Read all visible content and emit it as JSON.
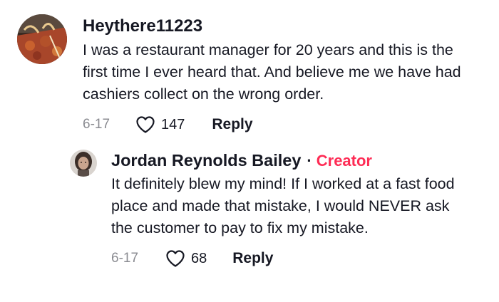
{
  "comments": [
    {
      "username": "Heythere11223",
      "text": "I was a restaurant manager for 20 years and this is the first time I ever heard that. And believe me we have had cashiers collect on the wrong order.",
      "date": "6-17",
      "likes": "147",
      "reply_label": "Reply",
      "avatar_icon": "pizza-avatar"
    }
  ],
  "reply": {
    "username": "Jordan Reynolds Bailey",
    "separator": "·",
    "badge": "Creator",
    "text": "It definitely blew my mind! If I worked at a fast food place and made that mistake, I would NEVER ask the customer to pay to fix my mistake.",
    "date": "6-17",
    "likes": "68",
    "reply_label": "Reply",
    "avatar_icon": "person-avatar"
  },
  "colors": {
    "creator_badge": "#fe2c55",
    "meta_gray": "#8a8b91",
    "text": "#161823"
  }
}
